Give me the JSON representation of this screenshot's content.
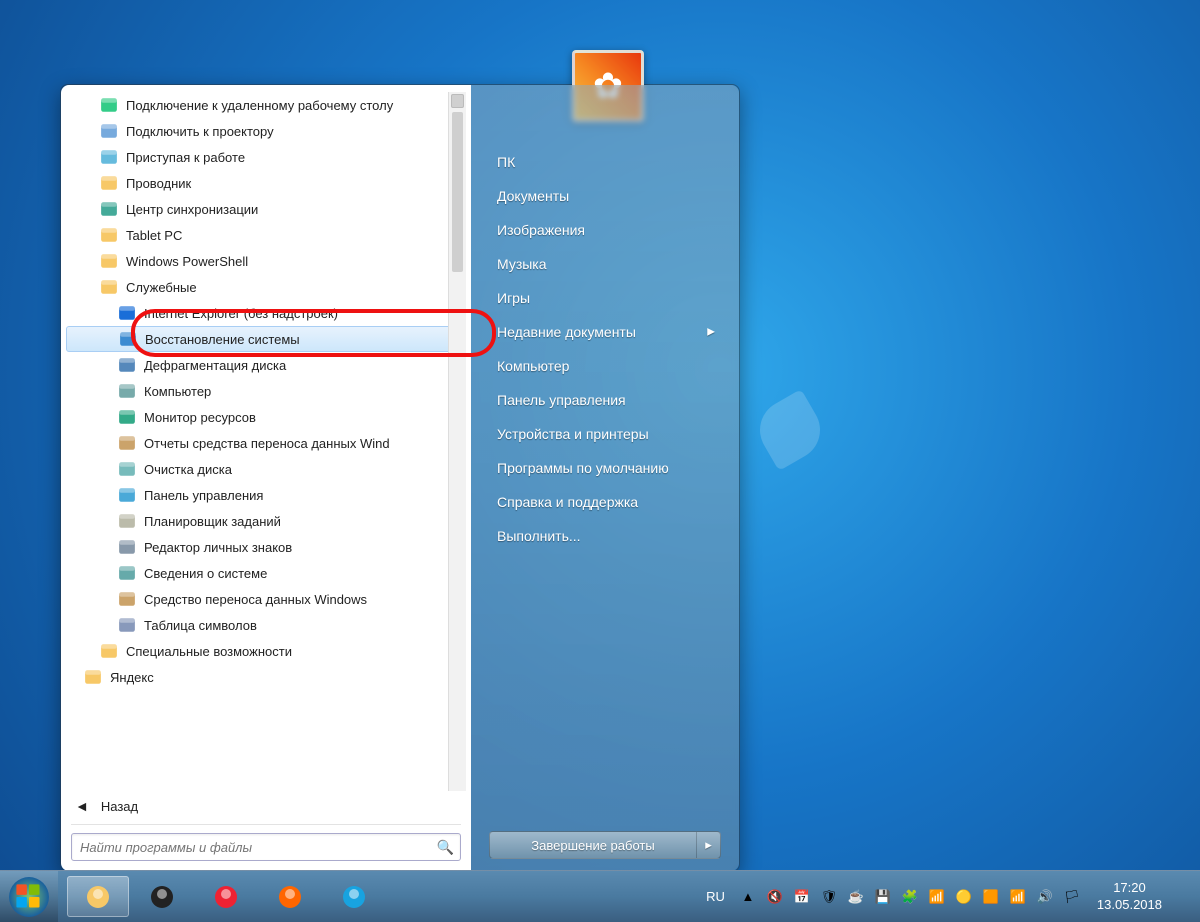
{
  "desktop": {},
  "start_menu": {
    "programs": [
      {
        "label": "Подключение к удаленному рабочему столу",
        "icon": "rdp",
        "indent": 1
      },
      {
        "label": "Подключить к проектору",
        "icon": "projector",
        "indent": 1
      },
      {
        "label": "Приступая к работе",
        "icon": "getstarted",
        "indent": 1
      },
      {
        "label": "Проводник",
        "icon": "explorer",
        "indent": 1
      },
      {
        "label": "Центр синхронизации",
        "icon": "sync",
        "indent": 1
      },
      {
        "label": "Tablet PC",
        "icon": "folder",
        "indent": 1
      },
      {
        "label": "Windows PowerShell",
        "icon": "folder",
        "indent": 1
      },
      {
        "label": "Служебные",
        "icon": "folder",
        "indent": 1
      },
      {
        "label": "Internet Explorer (без надстроек)",
        "icon": "ie",
        "indent": 2
      },
      {
        "label": "Восстановление системы",
        "icon": "restore",
        "indent": 2,
        "selected": true,
        "highlight": true
      },
      {
        "label": "Дефрагментация диска",
        "icon": "defrag",
        "indent": 2
      },
      {
        "label": "Компьютер",
        "icon": "computer",
        "indent": 2
      },
      {
        "label": "Монитор ресурсов",
        "icon": "resmon",
        "indent": 2
      },
      {
        "label": "Отчеты средства переноса данных Wind",
        "icon": "report",
        "indent": 2
      },
      {
        "label": "Очистка диска",
        "icon": "cleanup",
        "indent": 2
      },
      {
        "label": "Панель управления",
        "icon": "cpanel",
        "indent": 2
      },
      {
        "label": "Планировщик заданий",
        "icon": "tasksched",
        "indent": 2
      },
      {
        "label": "Редактор личных знаков",
        "icon": "charedit",
        "indent": 2
      },
      {
        "label": "Сведения о системе",
        "icon": "sysinfo",
        "indent": 2
      },
      {
        "label": "Средство переноса данных Windows",
        "icon": "transfer",
        "indent": 2
      },
      {
        "label": "Таблица символов",
        "icon": "charmap",
        "indent": 2
      },
      {
        "label": "Специальные возможности",
        "icon": "folder",
        "indent": 1
      },
      {
        "label": "Яндекс",
        "icon": "folder",
        "indent": 0
      }
    ],
    "back_label": "Назад",
    "search_placeholder": "Найти программы и файлы"
  },
  "right_panel": {
    "items": [
      {
        "label": "ПК"
      },
      {
        "label": "Документы"
      },
      {
        "label": "Изображения"
      },
      {
        "label": "Музыка"
      },
      {
        "label": "Игры"
      },
      {
        "label": "Недавние документы",
        "submenu": true
      },
      {
        "label": "Компьютер"
      },
      {
        "label": "Панель управления"
      },
      {
        "label": "Устройства и принтеры"
      },
      {
        "label": "Программы по умолчанию"
      },
      {
        "label": "Справка и поддержка"
      },
      {
        "label": "Выполнить..."
      }
    ],
    "shutdown_label": "Завершение работы"
  },
  "taskbar": {
    "lang": "RU",
    "time": "17:20",
    "date": "13.05.2018",
    "pinned": [
      {
        "name": "explorer",
        "color": "#f7c867"
      },
      {
        "name": "panda",
        "color": "#222"
      },
      {
        "name": "opera",
        "color": "#e23"
      },
      {
        "name": "firefox",
        "color": "#f60"
      },
      {
        "name": "skype",
        "color": "#18a3e0"
      }
    ],
    "tray": [
      {
        "name": "tray-arrow"
      },
      {
        "name": "tray-mute"
      },
      {
        "name": "tray-calendar"
      },
      {
        "name": "tray-av"
      },
      {
        "name": "tray-java"
      },
      {
        "name": "tray-disk"
      },
      {
        "name": "tray-puzzle"
      },
      {
        "name": "tray-signal1"
      },
      {
        "name": "tray-yandex"
      },
      {
        "name": "tray-orange"
      },
      {
        "name": "tray-signal2"
      },
      {
        "name": "tray-vol"
      },
      {
        "name": "tray-flag"
      }
    ]
  },
  "colors": {
    "accent": "#1775c7",
    "highlight": "#e11"
  }
}
